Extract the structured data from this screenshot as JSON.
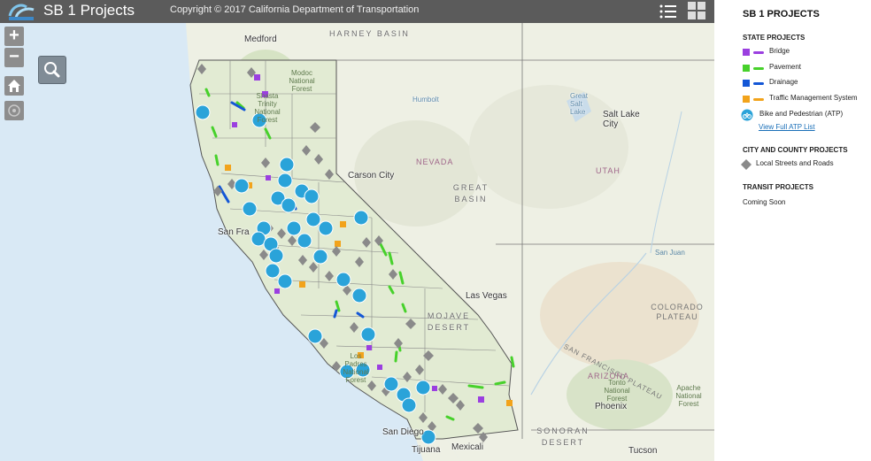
{
  "header": {
    "app_title": "SB 1 Projects",
    "copyright": "Copyright © 2017 California Department of Transportation",
    "logo_text": "Caltrans",
    "bg_color": "#5b5b5b"
  },
  "map_controls": {
    "zoom_in": "+",
    "zoom_out": "−"
  },
  "map": {
    "water_color": "#d9e9f5",
    "land_color": "#eef0e4",
    "places": [
      "Medford",
      "Carson City",
      "San Fra",
      "Las Vegas",
      "Salt Lake City",
      "Phoenix",
      "San Diego",
      "Tijuana",
      "Mexicali",
      "Tucson",
      "Great Salt Lake",
      "Humbolt"
    ],
    "regions": [
      "HARNEY BASIN",
      "NEVADA",
      "GREAT BASIN",
      "UTAH",
      "MOJAVE DESERT",
      "COLORADO PLATEAU",
      "SAN FRANCISCO PLATEAU",
      "ARIZONA",
      "SONORAN DESERT"
    ],
    "park_labels": [
      "Modoc National Forest",
      "Shasta Trinity National Forest",
      "Tonto National Forest",
      "Apache National Forest",
      "Los Padres National Forest",
      "San Juan"
    ]
  },
  "legend": {
    "title": "SB 1 PROJECTS",
    "state_section": "STATE PROJECTS",
    "state_items": [
      {
        "label": "Bridge",
        "color": "#9b3fe0",
        "icon": "square-line"
      },
      {
        "label": "Pavement",
        "color": "#47d12b",
        "icon": "square-line"
      },
      {
        "label": "Drainage",
        "color": "#1457d6",
        "icon": "square-line"
      },
      {
        "label": "Traffic Management System",
        "color": "#f2a31b",
        "icon": "square-line"
      },
      {
        "label": "Bike and Pedestrian (ATP)",
        "color": "#2aa3d9",
        "icon": "bike-icon"
      }
    ],
    "atp_link": "View Full ATP List",
    "city_section": "CITY AND COUNTY PROJECTS",
    "city_items": [
      {
        "label": "Local Streets and Roads",
        "color": "#8a8a8a",
        "icon": "diamond-icon"
      }
    ],
    "transit_section": "TRANSIT PROJECTS",
    "transit_status": "Coming Soon"
  }
}
